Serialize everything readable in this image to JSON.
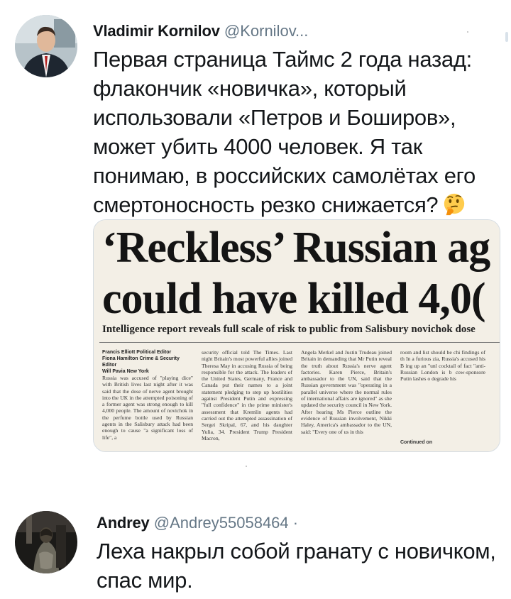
{
  "tweets": [
    {
      "name": "Vladimir Kornilov",
      "handle": "@Kornilov...",
      "text_lines": [
        "Первая страница Таймс 2 года назад:",
        "флакончик «новичка», который",
        "использовали «Петров и Боширов»,",
        "может убить 4000 человек. Я так",
        "понимаю, в российских самолётах его",
        "смертоносность резко снижается?"
      ],
      "emoji": "thinking-face",
      "media": {
        "headline_1": "‘Reckless’ Russian ag",
        "headline_2": "could have killed 4,0(",
        "subhead": "Intelligence report reveals full scale of risk to public from Salisbury novichok dose",
        "bylines": [
          "Francis Elliott Political Editor",
          "Fiona Hamilton Crime & Security Editor",
          "Will Pavia New York"
        ],
        "columns": [
          "Russia was accused of \"playing dice\" with British lives last night after it was said that the dose of nerve agent brought into the UK in the attempted poisoning of a former agent was strong enough to kill 4,000 people. The amount of novichok in the perfume bottle used by Russian agents in the Salisbury attack had been enough to cause \"a significant loss of life\", a",
          "security official told The Times. Last night Britain's most powerful allies joined Theresa May in accusing Russia of being responsible for the attack. The leaders of the United States, Germany, France and Canada put their names to a joint statement pledging to step up hostilities against President Putin and expressing \"full confidence\" in the prime minister's assessment that Kremlin agents had carried out the attempted assassination of Sergei Skripal, 67, and his daughter Yulia, 34. President Trump President Macron,",
          "Angela Merkel and Justin Trudeau joined Britain in demanding that Mr Putin reveal the truth about Russia's nerve agent factories. Karen Pierce, Britain's ambassador to the UN, said that the Russian government was \"operating in a parallel universe where the normal rules of international affairs are ignored\" as she updated the security council in New York. After hearing Ms Pierce outline the evidence of Russian involvement, Nikki Haley, America's ambassador to the UN, said: \"Every one of us in this",
          "room and list should be chi findings of th In a furious zia, Russia's accused his B ing up an \"unl cocktail of fact \"anti-Russian London is b cow-sponsore Putin lashes o degrade his"
        ],
        "continued": "Continued on"
      }
    },
    {
      "name": "Andrey",
      "handle": "@Andrey55058464",
      "separator": "·",
      "text_lines": [
        "Леха накрыл собой гранату с новичком,",
        "спас мир."
      ]
    }
  ],
  "colors": {
    "text": "#14171a",
    "handle": "#657786",
    "border": "#d5dce2",
    "newsprint": "#f3efe6"
  }
}
